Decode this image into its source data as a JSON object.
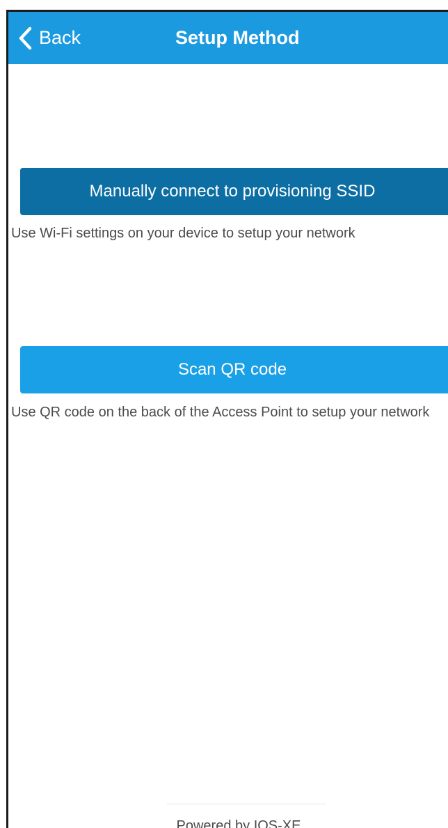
{
  "navbar": {
    "back_label": "Back",
    "title": "Setup Method",
    "back_icon": "chevron-left-icon",
    "background_color": "#1b9ae0"
  },
  "methods": [
    {
      "button_label": "Manually connect to provisioning SSID",
      "description": "Use Wi-Fi settings on your device to setup your network",
      "button_color": "#0c6ea3"
    },
    {
      "button_label": "Scan QR code",
      "description": "Use QR code on the back of the Access Point to setup your network",
      "button_color": "#1aa0e6"
    }
  ],
  "footer": {
    "text": "Powered by IOS-XE"
  }
}
